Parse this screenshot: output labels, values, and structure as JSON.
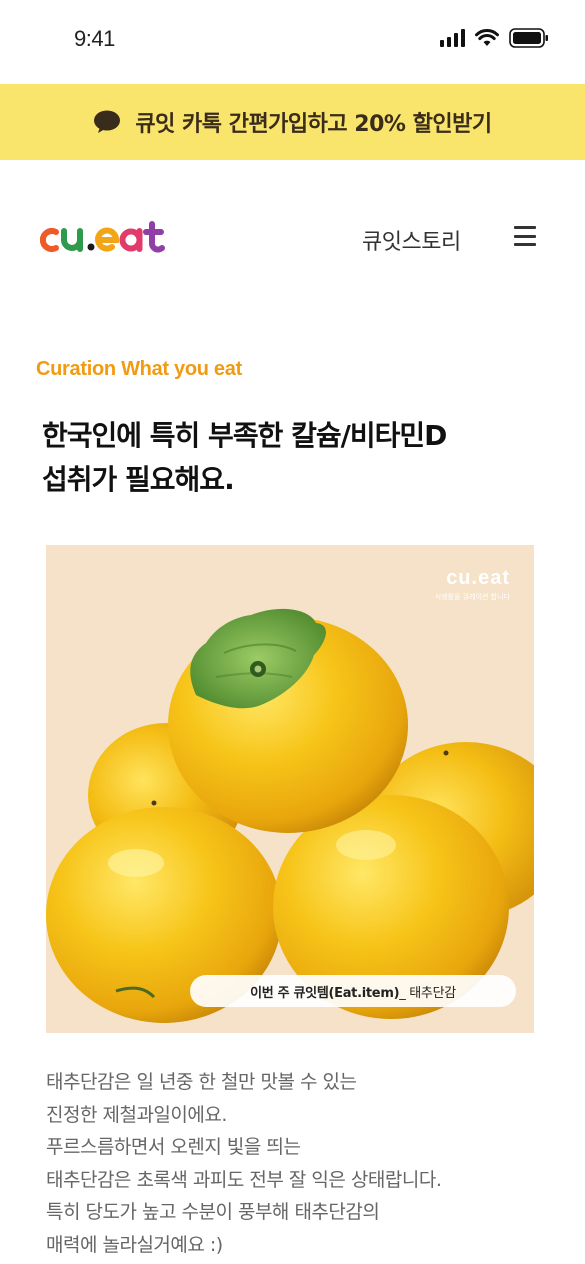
{
  "status_bar": {
    "time": "9:41"
  },
  "banner": {
    "text": "큐잇 카톡 간편가입하고 20% 할인받기",
    "icon": "speech-bubble-icon",
    "background": "#f9e46c"
  },
  "header": {
    "logo_text": "cu.eat",
    "nav_link": "큐잇스토리",
    "menu_icon": "hamburger-menu-icon"
  },
  "main": {
    "eyebrow": "Curation What you eat",
    "eyebrow_color": "#f29b12",
    "headline": [
      "한국인에 특히 부족한 칼슘/비타민D",
      "섭취가 필요해요."
    ],
    "image": {
      "watermark_logo": "cu.eat",
      "watermark_sub": "식생활을 큐레이션 합니다",
      "caption_strong": "이번 주 큐잇템(Eat.item)",
      "caption_rest": " _ 태추단감"
    },
    "description": [
      "태추단감은 일 년중 한 철만 맛볼 수 있는",
      "진정한 제철과일이에요.",
      "푸르스름하면서 오렌지 빛을 띄는",
      "태추단감은 초록색 과피도 전부 잘 익은 상태랍니다.",
      "특히 당도가 높고 수분이 풍부해 태추단감의",
      "매력에 놀라실거예요 :)"
    ]
  }
}
